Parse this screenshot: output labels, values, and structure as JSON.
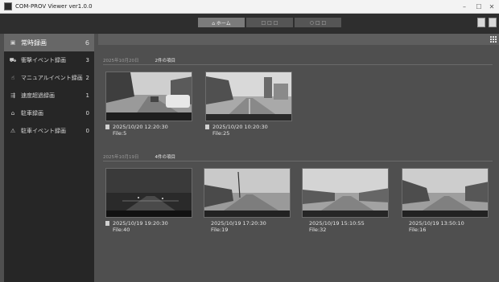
{
  "window": {
    "title": "COM-PROV Viewer ver1.0.0",
    "minimize": "–",
    "maximize": "☐",
    "close": "✕"
  },
  "tabs": [
    {
      "label": "⌂ ホーム"
    },
    {
      "label": "□ □ □"
    },
    {
      "label": "○ □ □"
    }
  ],
  "sidebar": {
    "items": [
      {
        "icon": "camera-icon",
        "label": "常時録画",
        "count": "6"
      },
      {
        "icon": "car-crash-icon",
        "label": "衝撃イベント録画",
        "count": "3"
      },
      {
        "icon": "hand-icon",
        "label": "マニュアルイベント録画",
        "count": "2"
      },
      {
        "icon": "car-speed-icon",
        "label": "速度超過録画",
        "count": "1"
      },
      {
        "icon": "parking-car-icon",
        "label": "駐車録画",
        "count": "0"
      },
      {
        "icon": "parking-event-icon",
        "label": "駐車イベント録画",
        "count": "0"
      }
    ]
  },
  "groups": [
    {
      "date": "2025年10月20日",
      "count_label": "2件の項目",
      "items": [
        {
          "datetime": "2025/10/20 12:20:30",
          "file": "File:5",
          "scene": "street-cars"
        },
        {
          "datetime": "2025/10/20 10:20:30",
          "file": "File:25",
          "scene": "city-road"
        }
      ]
    },
    {
      "date": "2025年10月19日",
      "count_label": "4件の項目",
      "items": [
        {
          "datetime": "2025/10/19 19:20:30",
          "file": "File:40",
          "scene": "night-road"
        },
        {
          "datetime": "2025/10/19 17:20:30",
          "file": "File:19",
          "scene": "highway-pole"
        },
        {
          "datetime": "2025/10/19 15:10:55",
          "file": "File:32",
          "scene": "highway-open"
        },
        {
          "datetime": "2025/10/19 13:50:10",
          "file": "File:16",
          "scene": "rural-road"
        }
      ]
    }
  ]
}
